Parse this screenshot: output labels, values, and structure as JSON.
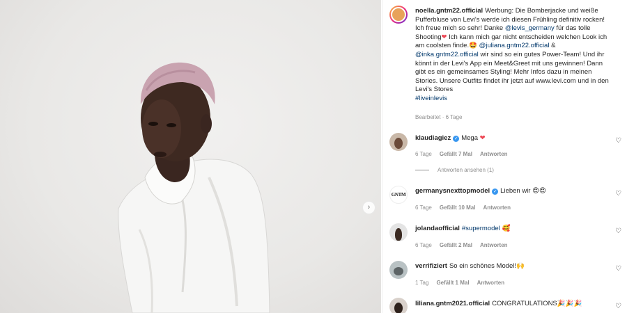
{
  "post": {
    "username": "noella.gntm22.official",
    "caption_line1": "Werbung: Die Bomberjacke und weiße",
    "caption_line2": "Pufferbluse von Levi's werde ich diesen Frühling definitiv rocken!",
    "caption_line3a": "Ich freue mich so sehr! Danke",
    "mention_levis": "@levis_germany",
    "caption_line3b": "für das tolle",
    "caption_line4a": "Shooting",
    "caption_line4b": "Ich kann mich gar nicht entscheiden welchen Look ich",
    "caption_line5": "am coolsten finde.",
    "mention_juliana": "@juliana.gntm22.official",
    "amp": "&",
    "mention_inka": "@inka.gntm22.official",
    "caption_line6": "wir sind so ein gutes Power-Team! Und ihr",
    "caption_line7": "könnt in der Levi's App ein Meet&Greet mit uns gewinnen! Dann",
    "caption_line8": "gibt es ein gemeinsames Styling! Mehr Infos dazu in meinen",
    "caption_line9": "Stories. Unsere Outfits findet ihr jetzt auf www.levi.com und in den",
    "caption_line10": "Levi's Stores",
    "hashtag": "#liveinlevis",
    "edited": "Bearbeitet · 6 Tage"
  },
  "comments": [
    {
      "username": "klaudiagiez",
      "verified": true,
      "text": "Mega",
      "emoji": "❤",
      "time": "6 Tage",
      "likes": "Gefällt 7 Mal",
      "reply": "Antworten"
    },
    {
      "username": "germanysnexttopmodel",
      "verified": true,
      "text": "Lieben wir",
      "emoji": "😍😍",
      "time": "6 Tage",
      "likes": "Gefällt 10 Mal",
      "reply": "Antworten"
    },
    {
      "username": "jolandaofficial",
      "verified": false,
      "text": "#supermodel",
      "emoji": "🥰",
      "time": "6 Tage",
      "likes": "Gefällt 2 Mal",
      "reply": "Antworten"
    },
    {
      "username": "verrifiziert",
      "verified": false,
      "text": "So ein schönes Model!",
      "emoji": "🙌",
      "time": "1 Tag",
      "likes": "Gefällt 1 Mal",
      "reply": "Antworten"
    },
    {
      "username": "liliana.gntm2021.official",
      "verified": false,
      "text": "CONGRATULATIONS",
      "emoji": "🎉🎉🎉"
    }
  ],
  "view_replies": "Antworten ansehen (1)",
  "gntm_logo": "GNTM",
  "icons": {
    "next": "chevron-right-icon",
    "like": "heart-outline-icon",
    "verified": "verified-badge-icon"
  },
  "colors": {
    "link": "#00376b",
    "meta": "#8e8e8e",
    "verified": "#3897f0",
    "heart": "#ed4956"
  }
}
